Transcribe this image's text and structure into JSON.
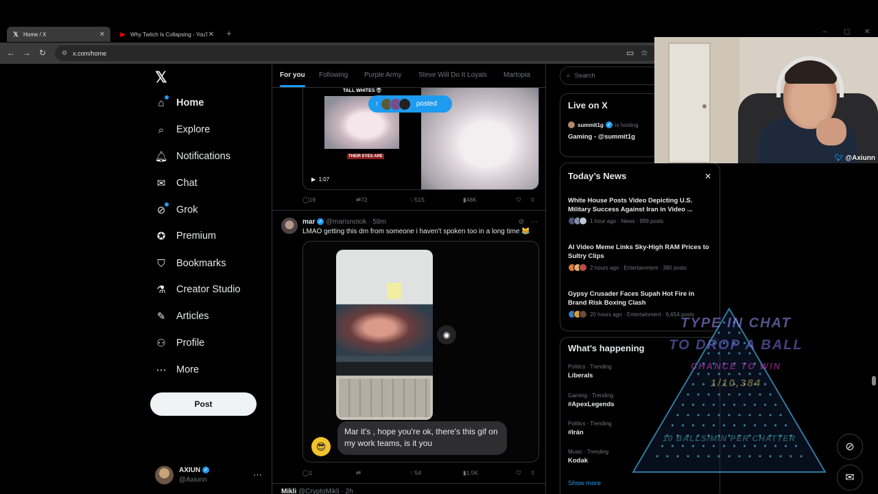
{
  "browser": {
    "tabs": [
      {
        "title": "Home / X",
        "icon": "x-logo-icon"
      },
      {
        "title": "Why Twitch Is Collapsing - YouT",
        "icon": "youtube-icon"
      }
    ],
    "url": "x.com/home"
  },
  "nav": {
    "items": [
      {
        "label": "Home",
        "icon": "home-icon"
      },
      {
        "label": "Explore",
        "icon": "search-icon"
      },
      {
        "label": "Notifications",
        "icon": "bell-icon"
      },
      {
        "label": "Chat",
        "icon": "mail-icon"
      },
      {
        "label": "Grok",
        "icon": "grok-icon"
      },
      {
        "label": "Premium",
        "icon": "premium-icon"
      },
      {
        "label": "Bookmarks",
        "icon": "bookmark-icon"
      },
      {
        "label": "Creator Studio",
        "icon": "flask-icon"
      },
      {
        "label": "Articles",
        "icon": "article-icon"
      },
      {
        "label": "Profile",
        "icon": "person-icon"
      },
      {
        "label": "More",
        "icon": "more-circle-icon"
      }
    ],
    "post_label": "Post",
    "account": {
      "name": "AXIUN",
      "handle": "@Axiunn"
    }
  },
  "feed": {
    "tabs": [
      "For you",
      "Following",
      "Purple Army",
      "Steve Will Do It Loyals",
      "Martopia"
    ],
    "posted_pill": "posted",
    "tweet1": {
      "media_title": "TALL WHITES 👽",
      "media_caption": "THEIR EYES ARE",
      "duration": "1:07",
      "replies": "19",
      "reposts": "72",
      "likes": "515",
      "views": "48K"
    },
    "tweet2": {
      "name": "mar",
      "handle": "@marisnotok",
      "time": "58m",
      "text": "LMAO getting this dm from someone i haven't spoken too in a long time 😹",
      "bubble": "Mar it's        , hope you're ok, there's this gif on my work teams, is it you",
      "replies": "1",
      "reposts": "",
      "likes": "54",
      "views": "1.5K"
    },
    "tweet3": {
      "name": "Mikli",
      "handle": "@CryptoMikli",
      "time": "2h"
    }
  },
  "sidebar": {
    "search_placeholder": "Search",
    "live": {
      "title": "Live on X",
      "host": "summit1g",
      "host_suffix": "is hosting",
      "stream_title": "Gaming - @summit1g"
    },
    "news": {
      "title": "Today’s News",
      "items": [
        {
          "headline": "White House Posts Video Depicting U.S. Military Success Against Iran in Video ...",
          "meta": "1 hour ago · News · 999 posts"
        },
        {
          "headline": "AI Video Meme Links Sky-High RAM Prices to Sultry Clips",
          "meta": "2 hours ago · Entertainment · 380 posts"
        },
        {
          "headline": "Gypsy Crusader Faces Supah Hot Fire in Brand Risk Boxing Clash",
          "meta": "20 hours ago · Entertainment · 6,654 posts"
        }
      ]
    },
    "happening": {
      "title": "What’s happening",
      "items": [
        {
          "category": "Politics · Trending",
          "topic": "Liberals"
        },
        {
          "category": "Gaming · Trending",
          "topic": "#ApexLegends"
        },
        {
          "category": "Politics · Trending",
          "topic": "#Irán"
        },
        {
          "category": "Music · Trending",
          "topic": "Kodak"
        }
      ],
      "show_more": "Show more"
    }
  },
  "overlay": {
    "webcam_tag": "@Axiunn",
    "plinko": {
      "line1": "TYPE IN CHAT",
      "line2": "TO DROP A BALL",
      "line3": "CHANCE TO WIN",
      "line4": "1/10,384",
      "line5": "10 BALLS/MIN PER CHATTER"
    }
  }
}
